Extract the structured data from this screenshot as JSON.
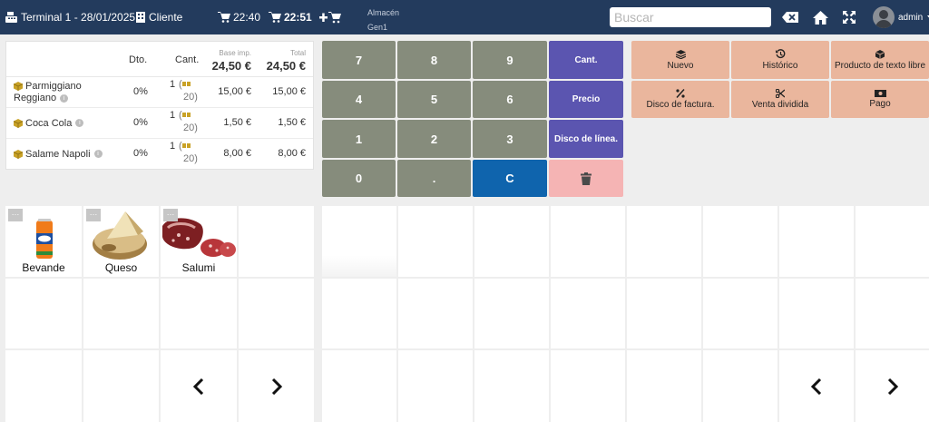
{
  "header": {
    "terminal": "Terminal 1 - 28/01/2025",
    "client": "Cliente",
    "time_1": "22:40",
    "time_2": "22:51",
    "warehouse_label": "Almacén",
    "warehouse_value": "Gen1",
    "search_placeholder": "Buscar",
    "user": "admin"
  },
  "ticket": {
    "col_discount": "Dto.",
    "col_quantity": "Cant.",
    "col_base_label": "Base imp.",
    "col_base_value": "24,50 €",
    "col_total_label": "Total",
    "col_total_value": "24,50 €",
    "lines": [
      {
        "name": "Parmiggiano Reggiano",
        "discount": "0%",
        "qty": "1",
        "stock": "20",
        "base": "15,00 €",
        "total": "15,00 €"
      },
      {
        "name": "Coca Cola",
        "discount": "0%",
        "qty": "1",
        "stock": "20",
        "base": "1,50 €",
        "total": "1,50 €"
      },
      {
        "name": "Salame Napoli",
        "discount": "0%",
        "qty": "1",
        "stock": "20",
        "base": "8,00 €",
        "total": "8,00 €"
      }
    ]
  },
  "keypad": {
    "k7": "7",
    "k8": "8",
    "k9": "9",
    "k4": "4",
    "k5": "5",
    "k6": "6",
    "k1": "1",
    "k2": "2",
    "k3": "3",
    "k0": "0",
    "dot": ".",
    "clear": "C",
    "qty": "Cant.",
    "price": "Precio",
    "line_disc": "Disco de línea."
  },
  "actions": {
    "new": "Nuevo",
    "history": "Histórico",
    "free_text": "Producto de texto libre",
    "invoice_disc": "Disco de factura.",
    "split": "Venta dividida",
    "pay": "Pago"
  },
  "families": [
    {
      "label": "Bevande",
      "icon": "fanta-can-image"
    },
    {
      "label": "Queso",
      "icon": "cheese-image"
    },
    {
      "label": "Salumi",
      "icon": "salami-image"
    }
  ],
  "colors": {
    "topbar": "#233b5d",
    "keypad_gray": "#868c7c",
    "keypad_purple": "#5b55b0",
    "keypad_blue": "#0f64ad",
    "keypad_red": "#f5b4b4",
    "action": "#eab69d"
  }
}
